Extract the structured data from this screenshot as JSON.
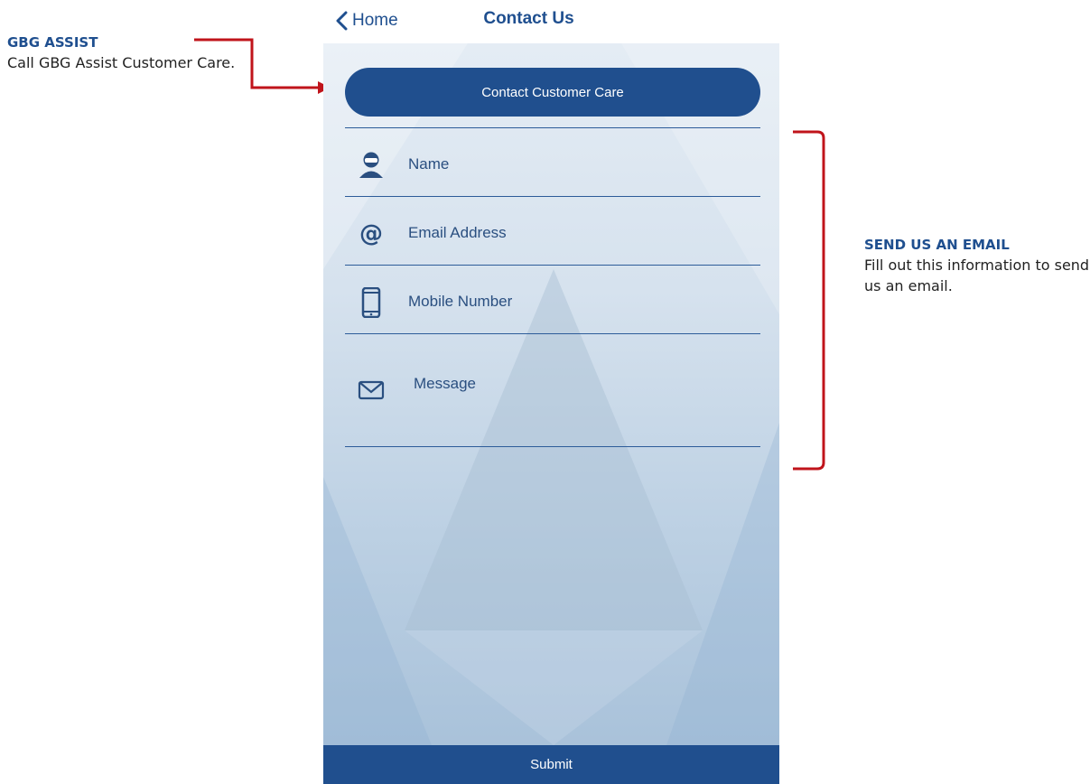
{
  "annotations": {
    "left": {
      "title": "GBG ASSIST",
      "text": "Call GBG Assist Customer Care."
    },
    "right": {
      "title": "SEND US AN EMAIL",
      "text": "Fill out this information to send us an email."
    },
    "accent_color": "#c0141b"
  },
  "navbar": {
    "back_label": "Home",
    "title": "Contact Us"
  },
  "form": {
    "contact_button_label": "Contact Customer Care",
    "fields": [
      {
        "icon": "user-icon",
        "placeholder": "Name"
      },
      {
        "icon": "at-icon",
        "placeholder": "Email Address"
      },
      {
        "icon": "mobile-phone-icon",
        "placeholder": "Mobile Number"
      },
      {
        "icon": "envelope-icon",
        "placeholder": "Message"
      }
    ],
    "submit_label": "Submit"
  },
  "colors": {
    "primary": "#204f8e",
    "text_label": "#1f4f8f"
  }
}
